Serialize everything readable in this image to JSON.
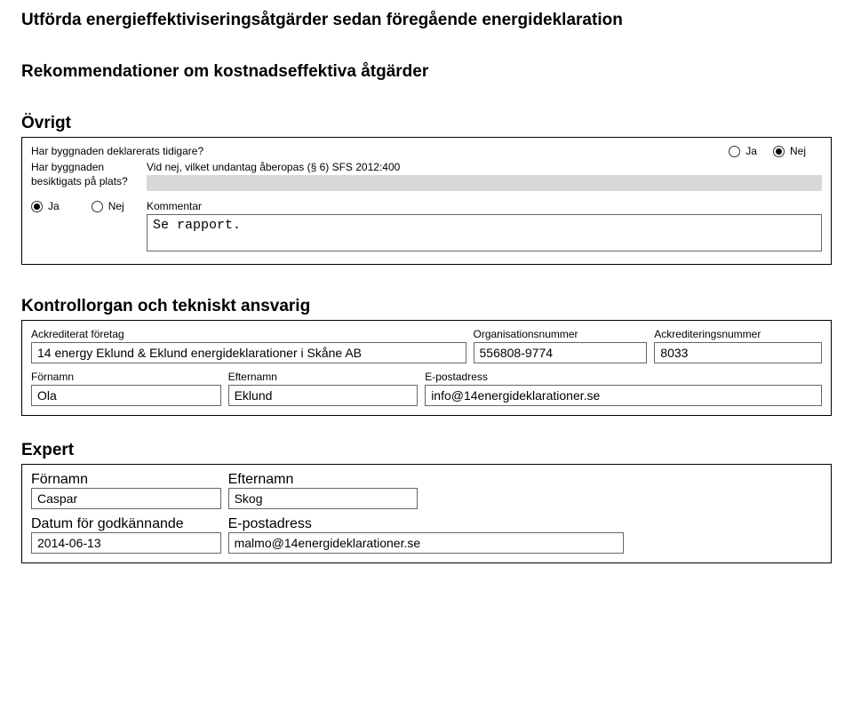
{
  "headings": {
    "h1": "Utförda energieffektiviseringsåtgärder sedan föregående energideklaration",
    "h2": "Rekommendationer om kostnadseffektiva åtgärder",
    "h3": "Övrigt",
    "h4": "Kontrollorgan och tekniskt ansvarig",
    "h5": "Expert"
  },
  "ovrigt": {
    "declared_q": "Har byggnaden deklarerats tidigare?",
    "ja": "Ja",
    "nej": "Nej",
    "inspected_q": "Har byggnaden besiktigats på plats?",
    "undantag_label": "Vid nej, vilket undantag åberopas (§ 6) SFS 2012:400",
    "kommentar_label": "Kommentar",
    "kommentar_value": "Se rapport."
  },
  "kontroll": {
    "labels": {
      "company": "Ackrediterat företag",
      "orgnr": "Organisationsnummer",
      "acknr": "Ackrediteringsnummer",
      "fname": "Förnamn",
      "lname": "Efternamn",
      "email": "E-postadress"
    },
    "company": "14 energy Eklund & Eklund energideklarationer i Skåne AB",
    "orgnr": "556808-9774",
    "acknr": "8033",
    "fname": "Ola",
    "lname": "Eklund",
    "email": "info@14energideklarationer.se"
  },
  "expert": {
    "labels": {
      "fname": "Förnamn",
      "lname": "Efternamn",
      "date": "Datum för godkännande",
      "email": "E-postadress"
    },
    "fname": "Caspar",
    "lname": "Skog",
    "date": "2014-06-13",
    "email": "malmo@14energideklarationer.se"
  }
}
